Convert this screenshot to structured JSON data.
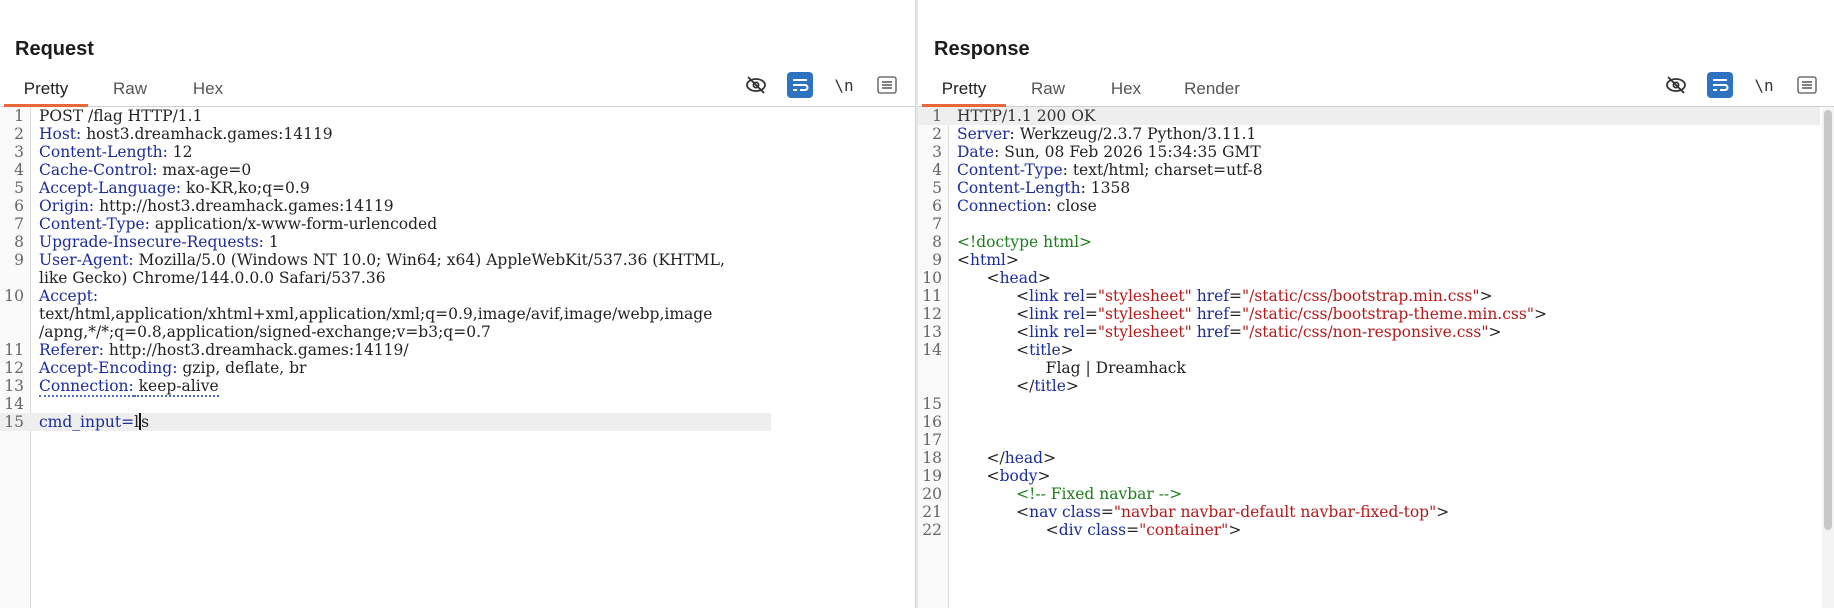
{
  "request": {
    "title": "Request",
    "tabs": [
      "Pretty",
      "Raw",
      "Hex"
    ],
    "active_tab": "Pretty",
    "toolbar": {
      "newline_label": "\\n"
    },
    "lines": [
      {
        "n": "1",
        "key": "",
        "val": "POST /flag HTTP/1.1"
      },
      {
        "n": "2",
        "key": "Host",
        "val": " host3.dreamhack.games:14119"
      },
      {
        "n": "3",
        "key": "Content-Length",
        "val": " 12"
      },
      {
        "n": "4",
        "key": "Cache-Control",
        "val": " max-age=0"
      },
      {
        "n": "5",
        "key": "Accept-Language",
        "val": " ko-KR,ko;q=0.9"
      },
      {
        "n": "6",
        "key": "Origin",
        "val": " http://host3.dreamhack.games:14119"
      },
      {
        "n": "7",
        "key": "Content-Type",
        "val": " application/x-www-form-urlencoded"
      },
      {
        "n": "8",
        "key": "Upgrade-Insecure-Requests",
        "val": " 1"
      },
      {
        "n": "9",
        "key": "User-Agent",
        "val": " Mozilla/5.0 (Windows NT 10.0; Win64; x64) AppleWebKit/537.36 (KHTML,"
      },
      {
        "n": "",
        "key": "",
        "val": "like Gecko) Chrome/144.0.0.0 Safari/537.36"
      },
      {
        "n": "10",
        "key": "Accept",
        "val": ""
      },
      {
        "n": "",
        "key": "",
        "val": "text/html,application/xhtml+xml,application/xml;q=0.9,image/avif,image/webp,image"
      },
      {
        "n": "",
        "key": "",
        "val": "/apng,*/*;q=0.8,application/signed-exchange;v=b3;q=0.7"
      },
      {
        "n": "11",
        "key": "Referer",
        "val": " http://host3.dreamhack.games:14119/"
      },
      {
        "n": "12",
        "key": "Accept-Encoding",
        "val": " gzip, deflate, br"
      },
      {
        "n": "13",
        "key": "Connection",
        "val": " keep-alive"
      },
      {
        "n": "14",
        "key": "",
        "val": ""
      },
      {
        "n": "15",
        "key": "",
        "val": ""
      }
    ],
    "body_param": "cmd_input",
    "body_value_before_caret": "l",
    "body_value_after_caret": "s"
  },
  "response": {
    "title": "Response",
    "tabs": [
      "Pretty",
      "Raw",
      "Hex",
      "Render"
    ],
    "active_tab": "Pretty",
    "toolbar": {
      "newline_label": "\\n"
    },
    "lines": [
      {
        "n": "1",
        "html": "<span class=\"grey\">HTTP/1.1 200 OK</span>"
      },
      {
        "n": "2",
        "html": "<span class=\"k\">Server</span>: Werkzeug/2.3.7 Python/3.11.1"
      },
      {
        "n": "3",
        "html": "<span class=\"k\">Date</span>: Sun, 08 Feb 2026 15:34:35 GMT"
      },
      {
        "n": "4",
        "html": "<span class=\"k\">Content-Type</span>: text/html; charset=utf-8"
      },
      {
        "n": "5",
        "html": "<span class=\"k\">Content-Length</span>: 1358"
      },
      {
        "n": "6",
        "html": "<span class=\"k\">Connection</span>: close"
      },
      {
        "n": "7",
        "html": ""
      },
      {
        "n": "8",
        "html": "<span class=\"cmt\">&lt;!doctype html&gt;</span>"
      },
      {
        "n": "9",
        "html": "&lt;<span class=\"tag\">html</span>&gt;"
      },
      {
        "n": "10",
        "html": "      &lt;<span class=\"tag\">head</span>&gt;"
      },
      {
        "n": "11",
        "html": "            &lt;<span class=\"tag\">link</span> <span class=\"attr\">rel</span>=<span class=\"str\">\"stylesheet\"</span> <span class=\"attr\">href</span>=<span class=\"str\">\"/static/css/bootstrap.min.css\"</span>&gt;"
      },
      {
        "n": "12",
        "html": "            &lt;<span class=\"tag\">link</span> <span class=\"attr\">rel</span>=<span class=\"str\">\"stylesheet\"</span> <span class=\"attr\">href</span>=<span class=\"str\">\"/static/css/bootstrap-theme.min.css\"</span>&gt;"
      },
      {
        "n": "13",
        "html": "            &lt;<span class=\"tag\">link</span> <span class=\"attr\">rel</span>=<span class=\"str\">\"stylesheet\"</span> <span class=\"attr\">href</span>=<span class=\"str\">\"/static/css/non-responsive.css\"</span>&gt;"
      },
      {
        "n": "14",
        "html": "            &lt;<span class=\"tag\">title</span>&gt;"
      },
      {
        "n": "",
        "html": "                  Flag | Dreamhack"
      },
      {
        "n": "",
        "html": "            &lt;/<span class=\"tag\">title</span>&gt;"
      },
      {
        "n": "15",
        "html": ""
      },
      {
        "n": "16",
        "html": ""
      },
      {
        "n": "17",
        "html": ""
      },
      {
        "n": "18",
        "html": "      &lt;/<span class=\"tag\">head</span>&gt;"
      },
      {
        "n": "19",
        "html": "      &lt;<span class=\"tag\">body</span>&gt;"
      },
      {
        "n": "20",
        "html": "            <span class=\"cmt\">&lt;!-- Fixed navbar --&gt;</span>"
      },
      {
        "n": "21",
        "html": "            &lt;<span class=\"tag\">nav</span> <span class=\"attr\">class</span>=<span class=\"str\">\"navbar navbar-default navbar-fixed-top\"</span>&gt;"
      },
      {
        "n": "22",
        "html": "                  &lt;<span class=\"tag\">div</span> <span class=\"attr\">class</span>=<span class=\"str\">\"container\"</span>&gt;"
      }
    ]
  },
  "layout_buttons": [
    "split-horizontal-icon",
    "split-vertical-icon",
    "single-pane-icon"
  ],
  "colors": {
    "accent": "#2e73c2",
    "tab_underline": "#e8683a",
    "keyword": "#1b2c9b",
    "string": "#b21a1a",
    "comment": "#1d7d1d"
  }
}
